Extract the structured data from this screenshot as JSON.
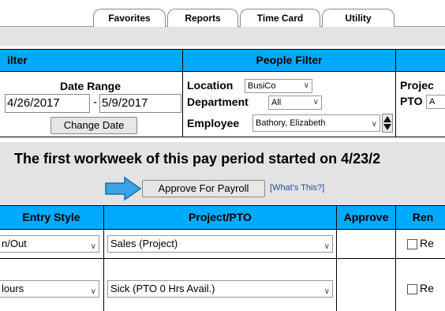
{
  "tabs": [
    "Favorites",
    "Reports",
    "Time Card",
    "Utility"
  ],
  "filter_left": {
    "header": "ilter",
    "date_range_label": "Date Range",
    "start_date": "4/26/2017",
    "separator": "-",
    "end_date": "5/9/2017",
    "change_date_button": "Change Date"
  },
  "people_filter": {
    "header": "People Filter",
    "location_label": "Location",
    "location_value": "BusiCo",
    "department_label": "Department",
    "department_value": "All",
    "employee_label": "Employee",
    "employee_value": "Bathory, Elizabeth"
  },
  "project_filter": {
    "project_label": "Projec",
    "pto_label": "PTO",
    "pto_value": "A"
  },
  "workweek_heading": "The first workweek of this pay period started on 4/23/2",
  "approve_button": "Approve For Payroll",
  "whats_this_link": "[What's This?]",
  "grid": {
    "headers": [
      "Entry Style",
      "Project/PTO",
      "Approve",
      "Ren"
    ],
    "rows": [
      {
        "entry_style": "n/Out",
        "project": "Sales (Project)",
        "remove_label": "Re"
      },
      {
        "entry_style": "lours",
        "project": "Sick (PTO 0 Hrs Avail.)",
        "remove_label": "Re"
      }
    ]
  },
  "colors": {
    "header_blue": "#00aaff",
    "arrow_blue": "#3ba3e6",
    "panel_gray": "#e3e3e3"
  }
}
